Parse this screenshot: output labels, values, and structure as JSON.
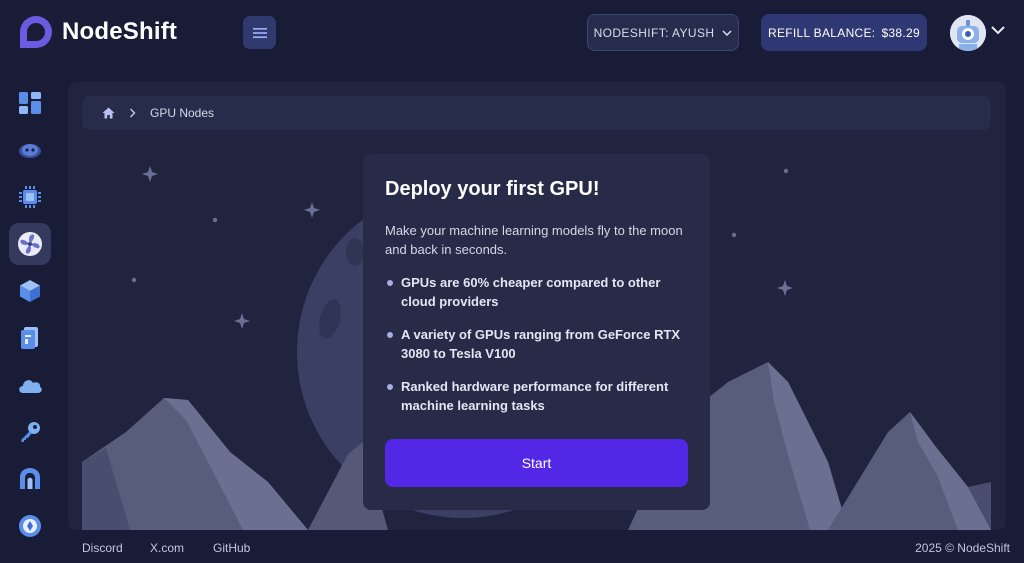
{
  "header": {
    "app_name": "NodeShift",
    "account_label": "NODESHIFT: AYUSH",
    "balance_label": "REFILL BALANCE:",
    "balance_value": "$38.29"
  },
  "sidebar": {
    "items": [
      {
        "icon": "dashboard-icon"
      },
      {
        "icon": "robot-icon"
      },
      {
        "icon": "chip-icon"
      },
      {
        "icon": "gpu-fan-icon",
        "active": true
      },
      {
        "icon": "cube-icon"
      },
      {
        "icon": "storage-icon"
      },
      {
        "icon": "cloud-icon"
      },
      {
        "icon": "key-icon"
      },
      {
        "icon": "nodes-icon"
      },
      {
        "icon": "settings-icon"
      }
    ]
  },
  "breadcrumb": {
    "home_icon": "home-icon",
    "current": "GPU Nodes"
  },
  "card": {
    "title": "Deploy your first GPU!",
    "intro": "Make your machine learning models fly to the moon and back in seconds.",
    "bullets": [
      "GPUs are 60% cheaper compared to other cloud providers",
      "A variety of GPUs ranging from GeForce RTX 3080 to Tesla V100",
      "Ranked hardware performance for different machine learning tasks"
    ],
    "start_label": "Start"
  },
  "footer": {
    "links": [
      "Discord",
      "X.com",
      "GitHub"
    ],
    "copyright": "2025 © NodeShift"
  },
  "colors": {
    "background": "#181c36",
    "panel": "#20243f",
    "card": "#272b48",
    "accent": "#5227e6",
    "sidebar_icon": "#5b8ee8"
  }
}
